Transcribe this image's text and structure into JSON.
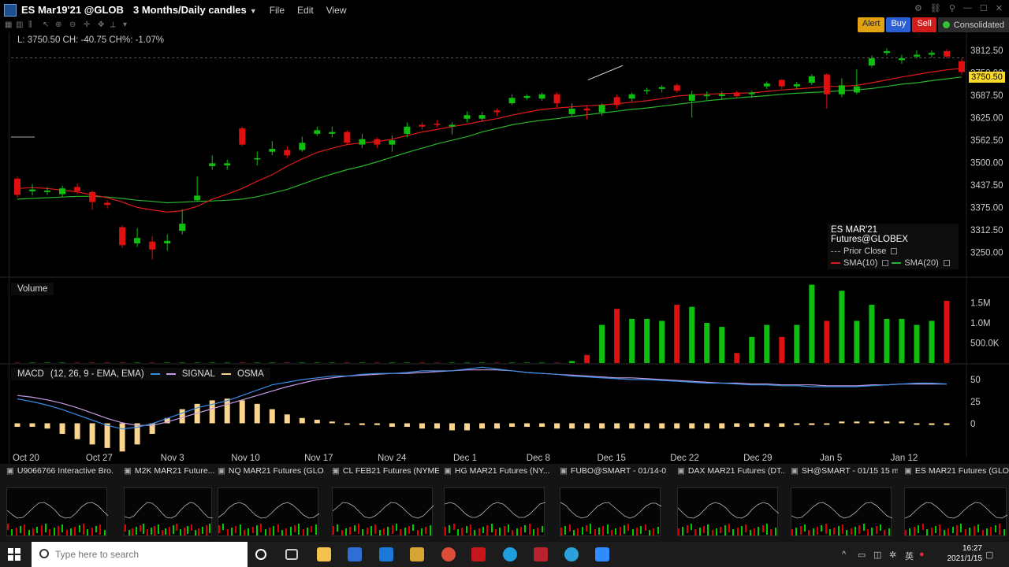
{
  "window": {
    "title": "ES Mar19'21 @GLOBEX",
    "period": "3 Months/Daily candles",
    "menu": [
      "File",
      "Edit",
      "View"
    ]
  },
  "orders": {
    "alert": "Alert",
    "buy": "Buy",
    "sell": "Sell",
    "consolidated": "Consolidated"
  },
  "readout": "L: 3750.50 CH: -40.75 CH%: -1.07%",
  "price_tag": "3750.50",
  "legend": {
    "title": "ES MAR'21 Futures@GLOBEX",
    "prior_close": "Prior Close",
    "sma10": "SMA(10)",
    "sma20": "SMA(20)"
  },
  "volume_label": "Volume",
  "macd": {
    "label": "MACD",
    "params": "(12, 26, 9 - EMA, EMA)",
    "signal": "SIGNAL",
    "osma": "OSMA"
  },
  "colors": {
    "up": "#0fbf0f",
    "down": "#e01010",
    "sma10": "#e01a1a",
    "sma20": "#29b329",
    "macd": "#3a8ee6",
    "signal": "#c59be6",
    "osma": "#f9d58d"
  },
  "chart_data": {
    "type": "candlestick",
    "price_axis": {
      "ticks": [
        "3812.50",
        "3750.00",
        "3687.50",
        "3625.00",
        "3562.50",
        "3500.00",
        "3437.50",
        "3375.00",
        "3312.50",
        "3250.00"
      ],
      "ylim": [
        3205,
        3845
      ]
    },
    "volume_axis": {
      "ticks": [
        "1.5M",
        "1.0M",
        "500.0K"
      ]
    },
    "macd_axis": {
      "ticks": [
        "50",
        "25",
        "0"
      ]
    },
    "x_ticks": [
      "Oct 20",
      "Oct 27",
      "Nov 3",
      "Nov 10",
      "Nov 17",
      "Nov 24",
      "Dec 1",
      "Dec 8",
      "Dec 15",
      "Dec 22",
      "Dec 29",
      "Jan 5",
      "Jan 12"
    ],
    "candles": [
      {
        "o": 3455,
        "c": 3410,
        "h": 3462,
        "l": 3402
      },
      {
        "o": 3420,
        "c": 3425,
        "h": 3440,
        "l": 3408
      },
      {
        "o": 3418,
        "c": 3422,
        "h": 3432,
        "l": 3410
      },
      {
        "o": 3412,
        "c": 3428,
        "h": 3436,
        "l": 3405
      },
      {
        "o": 3432,
        "c": 3420,
        "h": 3442,
        "l": 3412
      },
      {
        "o": 3418,
        "c": 3390,
        "h": 3422,
        "l": 3368
      },
      {
        "o": 3388,
        "c": 3382,
        "h": 3395,
        "l": 3372
      },
      {
        "o": 3320,
        "c": 3270,
        "h": 3325,
        "l": 3262
      },
      {
        "o": 3275,
        "c": 3290,
        "h": 3318,
        "l": 3265
      },
      {
        "o": 3280,
        "c": 3258,
        "h": 3295,
        "l": 3230
      },
      {
        "o": 3275,
        "c": 3282,
        "h": 3300,
        "l": 3255
      },
      {
        "o": 3310,
        "c": 3330,
        "h": 3370,
        "l": 3300
      },
      {
        "o": 3395,
        "c": 3408,
        "h": 3462,
        "l": 3390
      },
      {
        "o": 3490,
        "c": 3498,
        "h": 3520,
        "l": 3480
      },
      {
        "o": 3492,
        "c": 3498,
        "h": 3508,
        "l": 3480
      },
      {
        "o": 3595,
        "c": 3550,
        "h": 3600,
        "l": 3545
      },
      {
        "o": 3510,
        "c": 3512,
        "h": 3530,
        "l": 3492
      },
      {
        "o": 3530,
        "c": 3538,
        "h": 3560,
        "l": 3520
      },
      {
        "o": 3535,
        "c": 3520,
        "h": 3545,
        "l": 3512
      },
      {
        "o": 3535,
        "c": 3555,
        "h": 3572,
        "l": 3530
      },
      {
        "o": 3580,
        "c": 3590,
        "h": 3600,
        "l": 3574
      },
      {
        "o": 3580,
        "c": 3585,
        "h": 3600,
        "l": 3570
      },
      {
        "o": 3585,
        "c": 3555,
        "h": 3590,
        "l": 3550
      },
      {
        "o": 3550,
        "c": 3565,
        "h": 3580,
        "l": 3540
      },
      {
        "o": 3565,
        "c": 3550,
        "h": 3570,
        "l": 3540
      },
      {
        "o": 3550,
        "c": 3562,
        "h": 3575,
        "l": 3530
      },
      {
        "o": 3580,
        "c": 3600,
        "h": 3612,
        "l": 3570
      },
      {
        "o": 3605,
        "c": 3600,
        "h": 3612,
        "l": 3592
      },
      {
        "o": 3608,
        "c": 3605,
        "h": 3618,
        "l": 3598
      },
      {
        "o": 3600,
        "c": 3605,
        "h": 3612,
        "l": 3578
      },
      {
        "o": 3622,
        "c": 3632,
        "h": 3642,
        "l": 3612
      },
      {
        "o": 3622,
        "c": 3632,
        "h": 3640,
        "l": 3614
      },
      {
        "o": 3645,
        "c": 3640,
        "h": 3650,
        "l": 3630
      },
      {
        "o": 3665,
        "c": 3680,
        "h": 3690,
        "l": 3660
      },
      {
        "o": 3680,
        "c": 3685,
        "h": 3690,
        "l": 3675
      },
      {
        "o": 3678,
        "c": 3690,
        "h": 3695,
        "l": 3672
      },
      {
        "o": 3690,
        "c": 3665,
        "h": 3695,
        "l": 3655
      },
      {
        "o": 3635,
        "c": 3650,
        "h": 3665,
        "l": 3628
      },
      {
        "o": 3650,
        "c": 3645,
        "h": 3660,
        "l": 3620
      },
      {
        "o": 3640,
        "c": 3660,
        "h": 3665,
        "l": 3630
      },
      {
        "o": 3682,
        "c": 3660,
        "h": 3690,
        "l": 3650
      },
      {
        "o": 3678,
        "c": 3690,
        "h": 3695,
        "l": 3670
      },
      {
        "o": 3700,
        "c": 3702,
        "h": 3708,
        "l": 3690
      },
      {
        "o": 3705,
        "c": 3710,
        "h": 3715,
        "l": 3695
      },
      {
        "o": 3715,
        "c": 3700,
        "h": 3720,
        "l": 3695
      },
      {
        "o": 3672,
        "c": 3690,
        "h": 3700,
        "l": 3625
      },
      {
        "o": 3685,
        "c": 3688,
        "h": 3698,
        "l": 3675
      },
      {
        "o": 3685,
        "c": 3690,
        "h": 3698,
        "l": 3675
      },
      {
        "o": 3695,
        "c": 3685,
        "h": 3700,
        "l": 3680
      },
      {
        "o": 3690,
        "c": 3695,
        "h": 3700,
        "l": 3680
      },
      {
        "o": 3712,
        "c": 3720,
        "h": 3726,
        "l": 3705
      },
      {
        "o": 3730,
        "c": 3712,
        "h": 3732,
        "l": 3705
      },
      {
        "o": 3712,
        "c": 3718,
        "h": 3725,
        "l": 3705
      },
      {
        "o": 3722,
        "c": 3740,
        "h": 3746,
        "l": 3716
      },
      {
        "o": 3745,
        "c": 3690,
        "h": 3748,
        "l": 3650
      },
      {
        "o": 3690,
        "c": 3715,
        "h": 3735,
        "l": 3682
      },
      {
        "o": 3695,
        "c": 3712,
        "h": 3760,
        "l": 3690
      },
      {
        "o": 3770,
        "c": 3790,
        "h": 3798,
        "l": 3765
      },
      {
        "o": 3805,
        "c": 3810,
        "h": 3818,
        "l": 3798
      },
      {
        "o": 3785,
        "c": 3790,
        "h": 3800,
        "l": 3775
      },
      {
        "o": 3795,
        "c": 3800,
        "h": 3812,
        "l": 3790
      },
      {
        "o": 3800,
        "c": 3805,
        "h": 3812,
        "l": 3792
      },
      {
        "o": 3810,
        "c": 3795,
        "h": 3815,
        "l": 3790
      },
      {
        "o": 3782,
        "c": 3752,
        "h": 3790,
        "l": 3745
      }
    ],
    "sma10": [
      3428,
      3430,
      3428,
      3423,
      3418,
      3410,
      3402,
      3390,
      3375,
      3368,
      3362,
      3366,
      3378,
      3398,
      3412,
      3428,
      3448,
      3466,
      3490,
      3510,
      3528,
      3540,
      3550,
      3555,
      3558,
      3565,
      3575,
      3585,
      3592,
      3600,
      3607,
      3615,
      3622,
      3632,
      3640,
      3648,
      3652,
      3655,
      3658,
      3660,
      3664,
      3668,
      3672,
      3678,
      3685,
      3688,
      3690,
      3692,
      3693,
      3694,
      3698,
      3702,
      3705,
      3708,
      3712,
      3712,
      3715,
      3722,
      3730,
      3738,
      3745,
      3752,
      3758,
      3762
    ],
    "sma20": [
      3398,
      3400,
      3402,
      3404,
      3406,
      3406,
      3404,
      3400,
      3395,
      3392,
      3388,
      3390,
      3392,
      3393,
      3395,
      3398,
      3405,
      3415,
      3425,
      3440,
      3455,
      3468,
      3480,
      3490,
      3502,
      3515,
      3528,
      3540,
      3552,
      3562,
      3572,
      3585,
      3595,
      3605,
      3612,
      3618,
      3622,
      3628,
      3633,
      3638,
      3643,
      3648,
      3652,
      3657,
      3662,
      3667,
      3672,
      3676,
      3680,
      3683,
      3686,
      3690,
      3693,
      3695,
      3697,
      3700,
      3702,
      3706,
      3712,
      3718,
      3722,
      3728,
      3733,
      3738
    ],
    "volume": [
      0.01,
      0.01,
      0.01,
      0.01,
      0.01,
      0.01,
      0.01,
      0.01,
      0.01,
      0.01,
      0.01,
      0.01,
      0.01,
      0.01,
      0.01,
      0.01,
      0.01,
      0.01,
      0.01,
      0.01,
      0.01,
      0.01,
      0.01,
      0.01,
      0.01,
      0.01,
      0.01,
      0.01,
      0.01,
      0.01,
      0.01,
      0.01,
      0.01,
      0.01,
      0.01,
      0.01,
      0.01,
      0.05,
      0.2,
      0.95,
      1.35,
      1.1,
      1.1,
      1.05,
      1.45,
      1.4,
      1.0,
      0.9,
      0.25,
      0.65,
      0.95,
      0.65,
      0.95,
      1.95,
      1.05,
      1.8,
      1.05,
      1.45,
      1.1,
      1.1,
      0.95,
      1.05,
      1.55
    ],
    "macd_line": [
      28,
      25,
      21,
      16,
      10,
      4,
      -2,
      -6,
      -4,
      0,
      6,
      12,
      18,
      22,
      26,
      32,
      38,
      44,
      47,
      50,
      52,
      54,
      54,
      56,
      57,
      57,
      58,
      60,
      60,
      60,
      62,
      64,
      62,
      60,
      58,
      57,
      56,
      54,
      53,
      52,
      51,
      50,
      50,
      49,
      48,
      47,
      46,
      46,
      45,
      44,
      44,
      43,
      43,
      42,
      42,
      42,
      42,
      43,
      44,
      45,
      46,
      46,
      45
    ],
    "signal_line": [
      32,
      30,
      27,
      23,
      18,
      12,
      6,
      1,
      -2,
      -2,
      2,
      7,
      12,
      17,
      22,
      27,
      32,
      37,
      42,
      46,
      50,
      52,
      54,
      55,
      56,
      57,
      57,
      58,
      59,
      60,
      61,
      61,
      61,
      60,
      58,
      57,
      56,
      55,
      54,
      53,
      52,
      52,
      51,
      50,
      49,
      48,
      47,
      46,
      46,
      45,
      45,
      44,
      44,
      44,
      43,
      43,
      43,
      44,
      44,
      45,
      45,
      45,
      45
    ],
    "osma": [
      -2,
      -2,
      -3,
      -6,
      -9,
      -12,
      -14,
      -16,
      -12,
      -6,
      3,
      8,
      11,
      13,
      14,
      13,
      11,
      8,
      5,
      3,
      2,
      1,
      0,
      -1,
      -1,
      -2,
      -2,
      -3,
      -3,
      -4,
      -4,
      -3,
      -3,
      -2,
      -2,
      -2,
      -3,
      -3,
      -3,
      -3,
      -3,
      -3,
      -3,
      -3,
      -3,
      -3,
      -3,
      -3,
      -2,
      -2,
      -2,
      -2,
      -1,
      -1,
      0,
      1,
      1,
      1,
      1,
      1,
      0,
      -1,
      -1
    ]
  },
  "thumbnails": [
    {
      "title": "U9066766 Interactive Bro..."
    },
    {
      "title": "M2K MAR21 Future..."
    },
    {
      "title": "NQ MAR21 Futures (GLO..."
    },
    {
      "title": "CL FEB21 Futures (NYME..."
    },
    {
      "title": "HG MAR21 Futures (NY..."
    },
    {
      "title": "FUBO@SMART - 01/14-0..."
    },
    {
      "title": "DAX MAR21 Futures (DT..."
    },
    {
      "title": "SH@SMART - 01/15 15 m..."
    },
    {
      "title": "ES MAR21 Futures (GLOB..."
    }
  ],
  "taskbar": {
    "search_placeholder": "Type here to search",
    "time": "16:27",
    "date": "2021/1/15"
  }
}
